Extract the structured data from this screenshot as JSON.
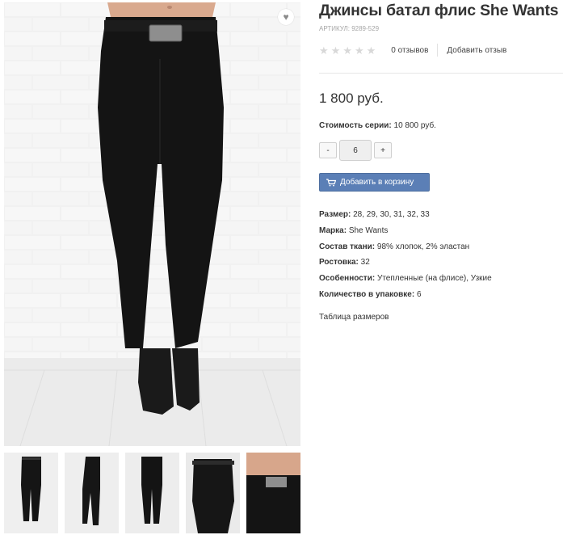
{
  "product": {
    "title": "Джинсы батал флис She Wants",
    "sku": "АРТИКУЛ: 9289-529",
    "reviews_count": "0 отзывов",
    "add_review": "Добавить отзыв",
    "price": "1 800 руб.",
    "series_label": "Стоимость серии:",
    "series_value": "10 800 руб.",
    "qty_minus": "-",
    "qty_plus": "+",
    "qty_value": "6",
    "add_to_cart": "Добавить в корзину",
    "size_table_link": "Таблица размеров"
  },
  "rating": {
    "stars_total": 5,
    "stars_filled": 0,
    "star_glyph": "★"
  },
  "specs": [
    {
      "label": "Размер:",
      "value": "28, 29, 30, 31, 32, 33"
    },
    {
      "label": "Марка:",
      "value": "She Wants"
    },
    {
      "label": "Состав ткани:",
      "value": "98% хлопок, 2% эластан"
    },
    {
      "label": "Ростовка:",
      "value": "32"
    },
    {
      "label": "Особенности:",
      "value": "Утепленные (на флисе), Узкие"
    },
    {
      "label": "Количество в упаковке:",
      "value": "6"
    }
  ],
  "icons": {
    "favorite": "heart-icon",
    "cart": "cart-icon",
    "star": "star-icon"
  },
  "colors": {
    "accent_button": "#5b7fb6",
    "star_empty": "#d8d8d8",
    "muted_text": "#a6a6a6"
  }
}
